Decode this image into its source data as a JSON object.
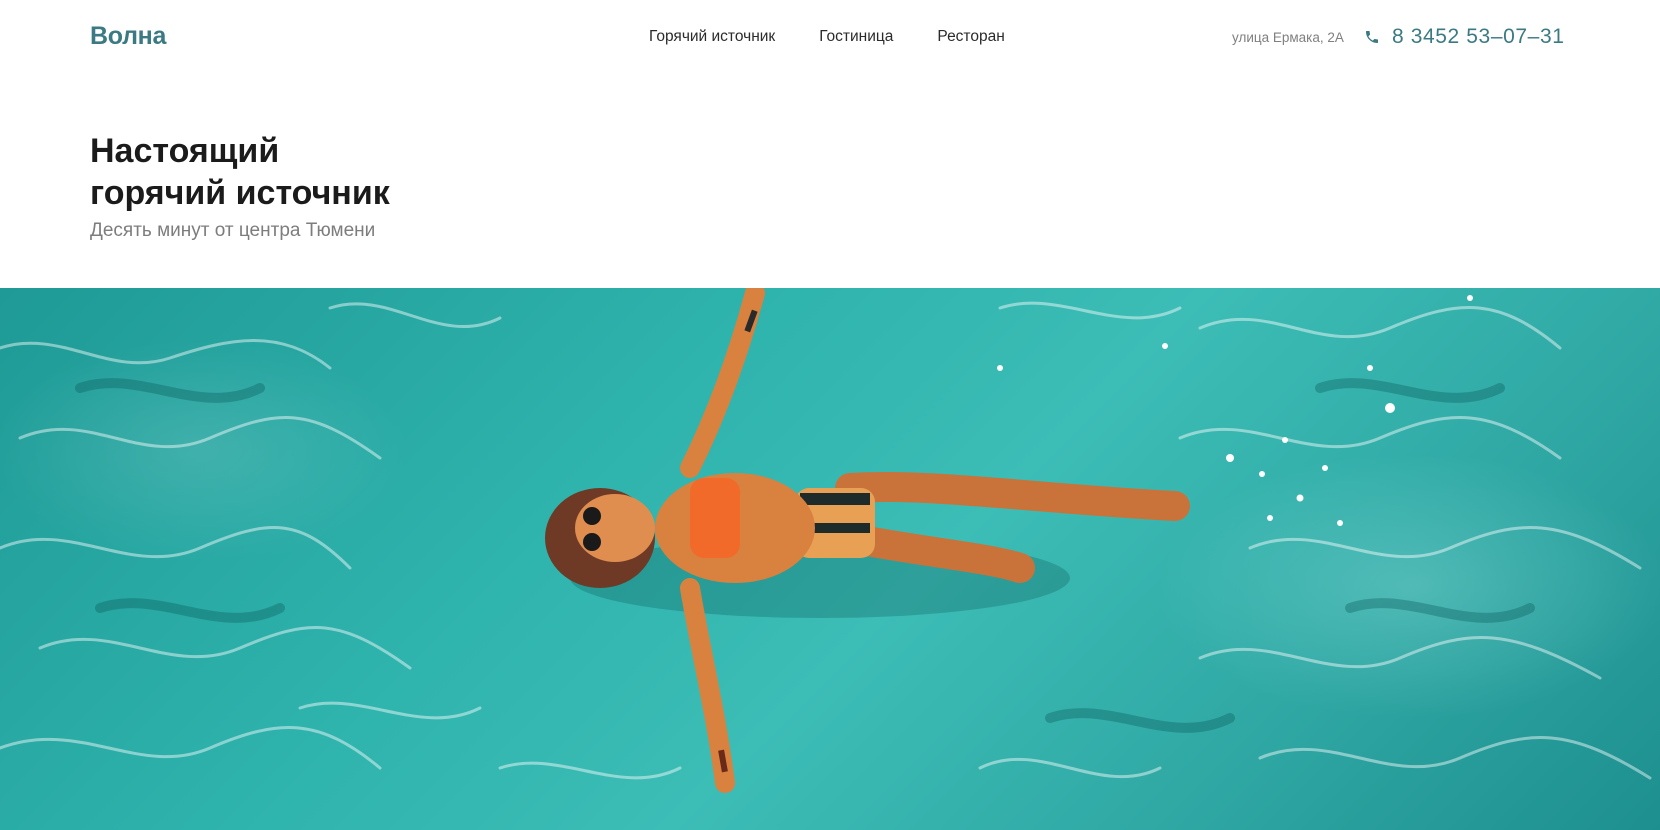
{
  "header": {
    "logo": "Волна",
    "nav": [
      {
        "label": "Горячий источник"
      },
      {
        "label": "Гостиница"
      },
      {
        "label": "Ресторан"
      }
    ],
    "address": "улица Ермака, 2А",
    "phone": "8  3452  53–07–31"
  },
  "hero": {
    "title_line1": "Настоящий",
    "title_line2": "горячий источник",
    "subtitle": "Десять минут от центра Тюмени"
  },
  "colors": {
    "accent": "#3b7a82",
    "water": "#2fb3ad",
    "swimsuit": "#f26a2a"
  },
  "icons": {
    "phone": "phone-icon"
  }
}
